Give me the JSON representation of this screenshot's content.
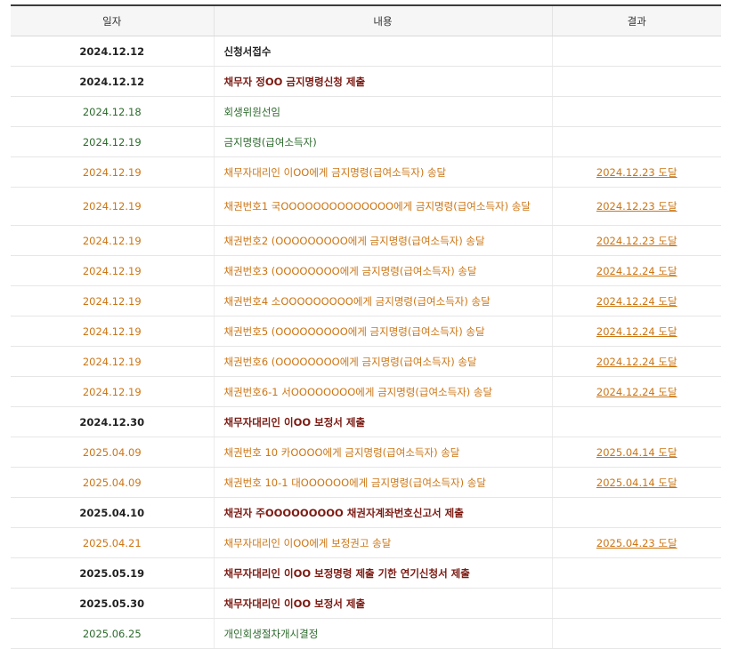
{
  "colors": {
    "black": "#222222",
    "maroon": "#7b1a12",
    "green": "#2c6a2c",
    "orange": "#cc7514"
  },
  "table": {
    "headers": {
      "date": "일자",
      "content": "내용",
      "result": "결과"
    },
    "rows": [
      {
        "date": "2024.12.12",
        "content": "신청서접수",
        "result": "",
        "style": "black"
      },
      {
        "date": "2024.12.12",
        "content": "채무자 정OO 금지명령신청 제출",
        "result": "",
        "style": "maroon"
      },
      {
        "date": "2024.12.18",
        "content": "회생위원선임",
        "result": "",
        "style": "green"
      },
      {
        "date": "2024.12.19",
        "content": "금지명령(급여소득자)",
        "result": "",
        "style": "green"
      },
      {
        "date": "2024.12.19",
        "content": "채무자대리인 이OO에게 금지명령(급여소득자) 송달",
        "result": "2024.12.23 도달",
        "style": "orange"
      },
      {
        "date": "2024.12.19",
        "content": "채권번호1 국OOOOOOOOOOOOOO에게 금지명령(급여소득자) 송달",
        "result": "2024.12.23 도달",
        "style": "orange",
        "tall": true
      },
      {
        "date": "2024.12.19",
        "content": "채권번호2 (OOOOOOOOO에게 금지명령(급여소득자) 송달",
        "result": "2024.12.23 도달",
        "style": "orange"
      },
      {
        "date": "2024.12.19",
        "content": "채권번호3 (OOOOOOOO에게 금지명령(급여소득자) 송달",
        "result": "2024.12.24 도달",
        "style": "orange"
      },
      {
        "date": "2024.12.19",
        "content": "채권번호4 소OOOOOOOOO에게 금지명령(급여소득자) 송달",
        "result": "2024.12.24 도달",
        "style": "orange"
      },
      {
        "date": "2024.12.19",
        "content": "채권번호5 (OOOOOOOOO에게 금지명령(급여소득자) 송달",
        "result": "2024.12.24 도달",
        "style": "orange"
      },
      {
        "date": "2024.12.19",
        "content": "채권번호6 (OOOOOOOO에게 금지명령(급여소득자) 송달",
        "result": "2024.12.24 도달",
        "style": "orange"
      },
      {
        "date": "2024.12.19",
        "content": "채권번호6-1 서OOOOOOOO에게 금지명령(급여소득자) 송달",
        "result": "2024.12.24 도달",
        "style": "orange"
      },
      {
        "date": "2024.12.30",
        "content": "채무자대리인 이OO 보정서 제출",
        "result": "",
        "style": "maroon"
      },
      {
        "date": "2025.04.09",
        "content": "채권번호 10 카OOOO에게 금지명령(급여소득자) 송달",
        "result": "2025.04.14 도달",
        "style": "orange"
      },
      {
        "date": "2025.04.09",
        "content": "채권번호 10-1 대OOOOOO에게 금지명령(급여소득자) 송달",
        "result": "2025.04.14 도달",
        "style": "orange"
      },
      {
        "date": "2025.04.10",
        "content": "채권자 주OOOOOOOOO 채권자계좌번호신고서 제출",
        "result": "",
        "style": "maroon"
      },
      {
        "date": "2025.04.21",
        "content": "채무자대리인 이OO에게 보정권고 송달",
        "result": "2025.04.23 도달",
        "style": "orange"
      },
      {
        "date": "2025.05.19",
        "content": "채무자대리인 이OO 보정명령 제출 기한 연기신청서 제출",
        "result": "",
        "style": "maroon"
      },
      {
        "date": "2025.05.30",
        "content": "채무자대리인 이OO 보정서 제출",
        "result": "",
        "style": "maroon"
      },
      {
        "date": "2025.06.25",
        "content": "개인회생절차개시결정",
        "result": "",
        "style": "green"
      }
    ]
  }
}
